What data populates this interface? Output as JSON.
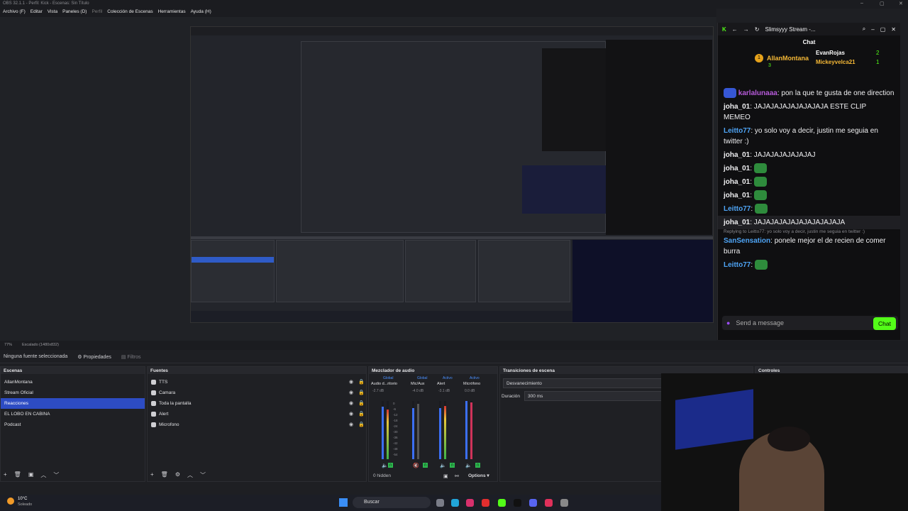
{
  "window": {
    "title": "OBS 32.1.1 - Perfil: Kick - Escenas: Sin Título"
  },
  "menu": {
    "archivo": "Archivo (F)",
    "editar": "Editar",
    "vista": "Vista",
    "paneles": "Paneles (D)",
    "perfil": "Perfil",
    "coleccion": "Colección de Escenas",
    "herramientas": "Herramientas",
    "ayuda": "Ayuda (H)"
  },
  "chat": {
    "window_title": "Slimsyyy Stream -...",
    "header": "Chat",
    "gifters": [
      {
        "rank": "1",
        "name": "AllanMontana",
        "count": "3"
      },
      {
        "name": "EvanRojas",
        "count": "2"
      },
      {
        "name": "Mickeyvelca21",
        "count": "1"
      }
    ],
    "messages": [
      {
        "user": "karlalunaaa",
        "text": ": pon la que te gusta de one direction",
        "color": "#b65ad9"
      },
      {
        "user": "joha_01",
        "text": ": JAJAJAJAJAJAJAJAJA ESTE CLIP MEMEO",
        "color": "#efeff1"
      },
      {
        "user": "Leitto77",
        "text": ": yo solo voy a decir, justin me seguia en twitter :)",
        "color": "#4ea4f5"
      },
      {
        "user": "joha_01",
        "text": ": JAJAJAJAJAJAJAJ",
        "color": "#efeff1"
      },
      {
        "user": "joha_01",
        "text": ":",
        "color": "#efeff1"
      },
      {
        "user": "joha_01",
        "text": ":",
        "color": "#efeff1"
      },
      {
        "user": "joha_01",
        "text": ":",
        "color": "#efeff1"
      },
      {
        "user": "Leitto77",
        "text": ":",
        "color": "#4ea4f5"
      },
      {
        "user": "joha_01",
        "text": ": JAJAJAJAJAJAJAJAJAJAJA",
        "color": "#efeff1"
      }
    ],
    "reply_note": "Replying to Leitto77: yo solo voy a decir, justin me seguia en twitter :)",
    "reply": {
      "user": "SanSensation",
      "text": ": ponele mejor el de recien de comer burra"
    },
    "last": {
      "user": "Leitto77",
      "text": ":"
    },
    "placeholder": "Send a message",
    "send": "Chat"
  },
  "status": {
    "zoom": "77%",
    "scale": "Escalado (1480x832)"
  },
  "toolbar": {
    "source": "Ninguna fuente seleccionada",
    "props": "Propiedades",
    "filters": "Filtros"
  },
  "scenes": {
    "title": "Escenas",
    "items": [
      "AllanMontana",
      "Stream Oficial",
      "Reacciones",
      "EL LOBO EN CABINA",
      "Podcast"
    ],
    "selected": 2
  },
  "sources": {
    "title": "Fuentes",
    "items": [
      "TTS",
      "Camara",
      "Toda la pantalla",
      "Alert",
      "Microfono"
    ]
  },
  "mixer": {
    "title": "Mezclador de audio",
    "channels": [
      {
        "tag": "Global",
        "name": "Audio d...ritorio",
        "db": "-2.7 dB"
      },
      {
        "tag": "Global",
        "name": "Mic/Aux",
        "db": "-4.0 dB"
      },
      {
        "tag": "Activo",
        "name": "Alert",
        "db": "-3.1 dB"
      },
      {
        "tag": "Activo",
        "name": "Micrófono",
        "db": "0.0 dB"
      }
    ],
    "scale": [
      "0",
      "-6",
      "-12",
      "-18",
      "-24",
      "-30",
      "-36",
      "-42",
      "-48",
      "-54",
      "-60"
    ],
    "hidden": "0 hidden",
    "options": "Options"
  },
  "transitions": {
    "title": "Transiciones de escena",
    "type": "Desvanecimiento",
    "duration_label": "Duración",
    "duration": "300 ms"
  },
  "controls": {
    "title": "Controles"
  },
  "weather": {
    "temp": "10°C",
    "cond": "Soleado"
  },
  "taskbar": {
    "search": "Buscar"
  }
}
